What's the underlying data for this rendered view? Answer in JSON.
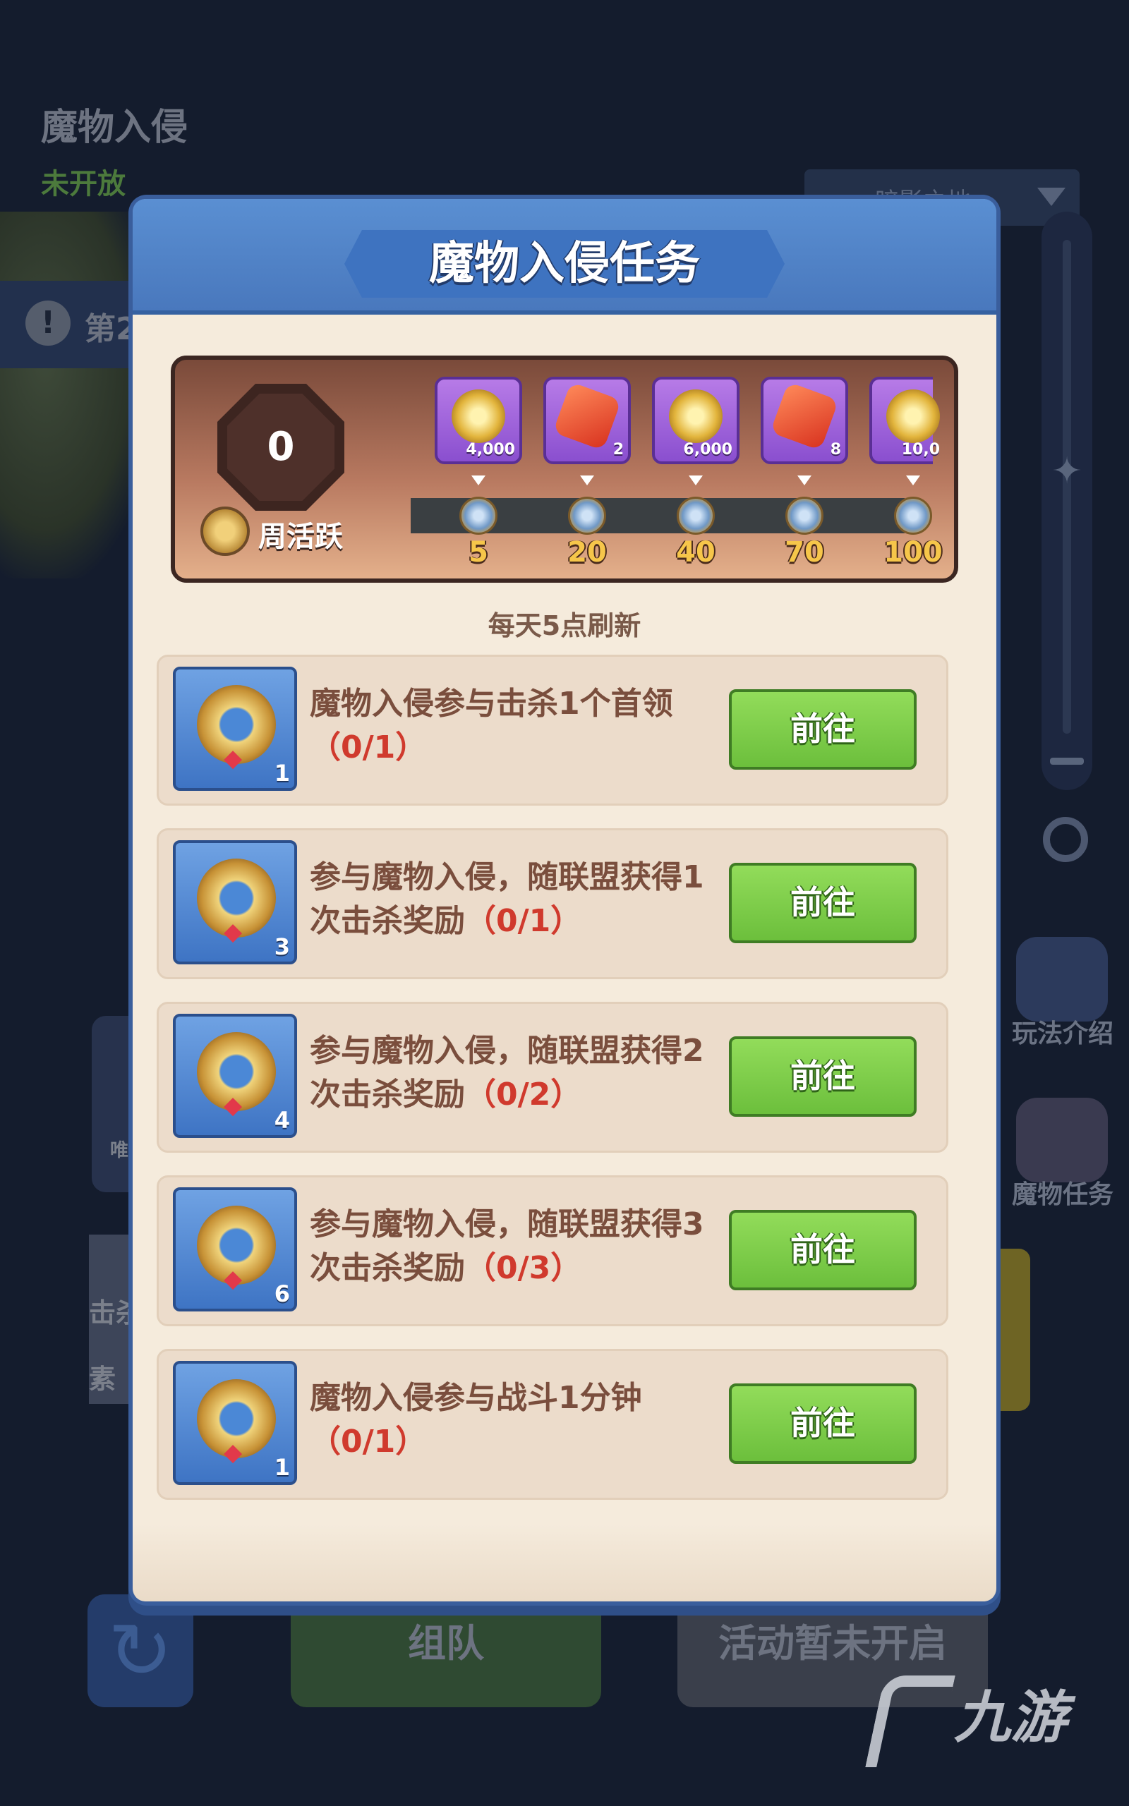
{
  "background": {
    "event_title": "魔物入侵",
    "event_status": "未开放",
    "dropdown_value": "暗影之地",
    "alert_label": "第2",
    "side_buttons": [
      "玩法介绍",
      "魔物任务"
    ],
    "left_texts": [
      "唯",
      "击杀",
      "素"
    ],
    "bottom_buttons": {
      "team": "组队",
      "not_started": "活动暂未开启"
    }
  },
  "watermark": {
    "text": "九游"
  },
  "modal": {
    "title": "魔物入侵任务",
    "weekly": {
      "value": "0",
      "label": "周活跃",
      "rewards": [
        {
          "type": "coin",
          "qty": "4,000",
          "threshold": "5"
        },
        {
          "type": "gem",
          "qty": "2",
          "threshold": "20"
        },
        {
          "type": "coin",
          "qty": "6,000",
          "threshold": "40"
        },
        {
          "type": "gem",
          "qty": "8",
          "threshold": "70"
        },
        {
          "type": "coin",
          "qty": "10,0",
          "threshold": "100"
        }
      ]
    },
    "refresh_note": "每天5点刷新",
    "tasks": [
      {
        "icon_count": "1",
        "text": "魔物入侵参与击杀1个首领",
        "progress": "（0/1）",
        "button": "前往"
      },
      {
        "icon_count": "3",
        "text": "参与魔物入侵，随联盟获得1次击杀奖励",
        "progress": "（0/1）",
        "button": "前往"
      },
      {
        "icon_count": "4",
        "text": "参与魔物入侵，随联盟获得2次击杀奖励",
        "progress": "（0/2）",
        "button": "前往"
      },
      {
        "icon_count": "6",
        "text": "参与魔物入侵，随联盟获得3次击杀奖励",
        "progress": "（0/3）",
        "button": "前往"
      },
      {
        "icon_count": "1",
        "text": "魔物入侵参与战斗1分钟",
        "progress": "（0/1）",
        "button": "前往"
      }
    ]
  }
}
